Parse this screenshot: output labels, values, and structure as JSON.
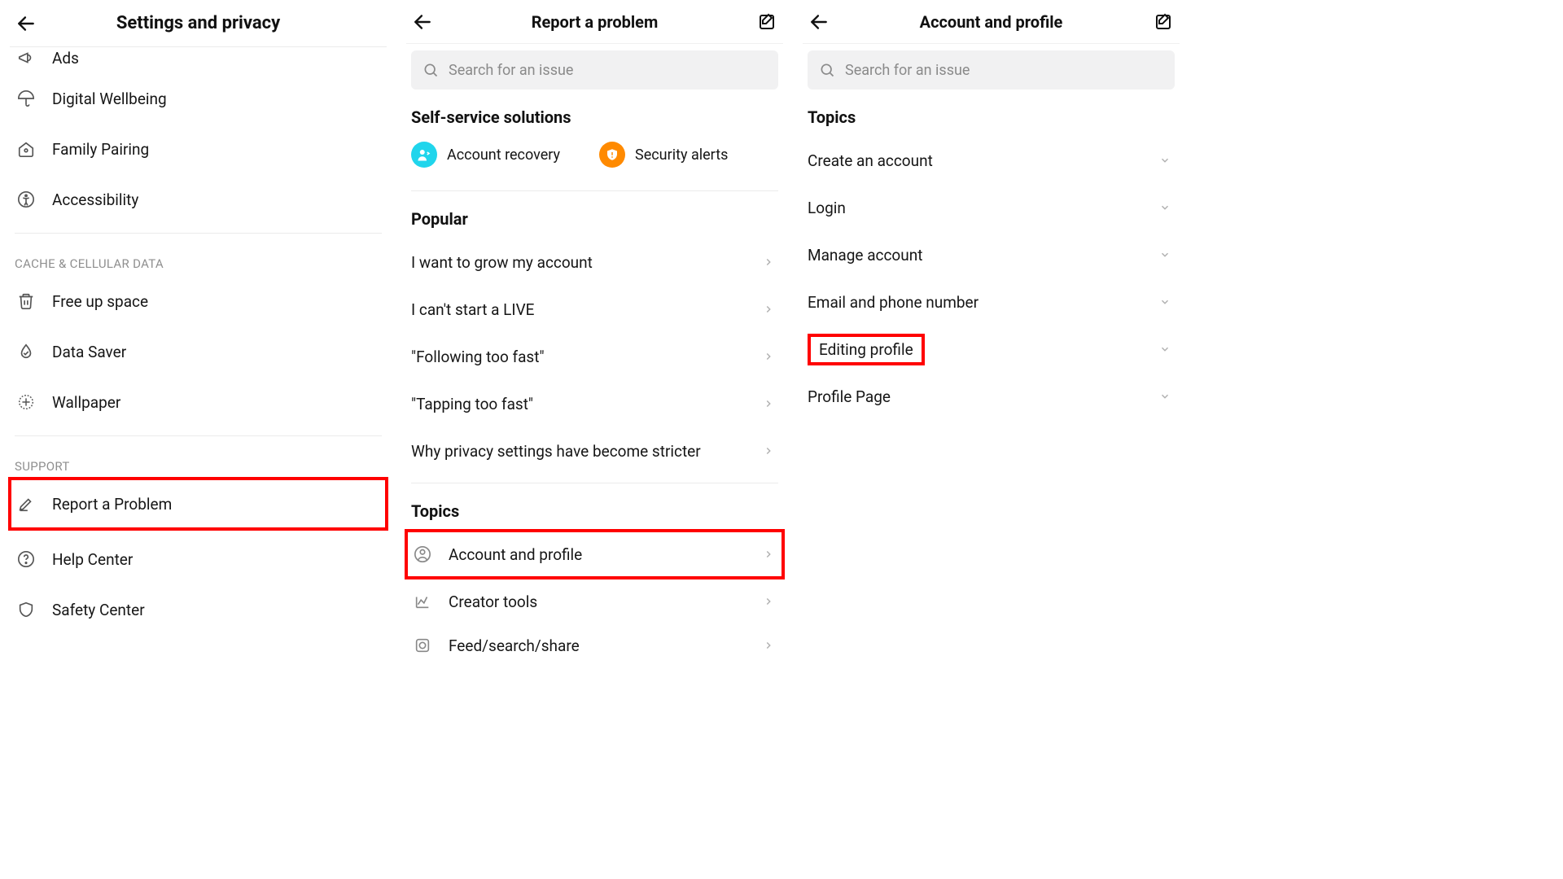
{
  "pane1": {
    "title": "Settings and privacy",
    "items_top": [
      {
        "label": "Ads"
      },
      {
        "label": "Digital Wellbeing"
      },
      {
        "label": "Family Pairing"
      },
      {
        "label": "Accessibility"
      }
    ],
    "section_cache": "CACHE & CELLULAR DATA",
    "items_cache": [
      {
        "label": "Free up space"
      },
      {
        "label": "Data Saver"
      },
      {
        "label": "Wallpaper"
      }
    ],
    "section_support": "SUPPORT",
    "items_support": [
      {
        "label": "Report a Problem"
      },
      {
        "label": "Help Center"
      },
      {
        "label": "Safety Center"
      }
    ]
  },
  "pane2": {
    "title": "Report a problem",
    "search_placeholder": "Search for an issue",
    "section_self": "Self-service solutions",
    "self_items": [
      {
        "label": "Account recovery"
      },
      {
        "label": "Security alerts"
      }
    ],
    "section_popular": "Popular",
    "popular_items": [
      {
        "label": "I want to grow my account"
      },
      {
        "label": "I can't start a LIVE"
      },
      {
        "label": "\"Following too fast\""
      },
      {
        "label": "\"Tapping too fast\""
      },
      {
        "label": "Why privacy settings have become stricter"
      }
    ],
    "section_topics": "Topics",
    "topic_items": [
      {
        "label": "Account and profile"
      },
      {
        "label": "Creator tools"
      },
      {
        "label": "Feed/search/share"
      }
    ]
  },
  "pane3": {
    "title": "Account and profile",
    "search_placeholder": "Search for an issue",
    "section_topics": "Topics",
    "topic_items": [
      {
        "label": "Create an account"
      },
      {
        "label": "Login"
      },
      {
        "label": "Manage account"
      },
      {
        "label": "Email and phone number"
      },
      {
        "label": "Editing profile"
      },
      {
        "label": "Profile Page"
      }
    ]
  }
}
